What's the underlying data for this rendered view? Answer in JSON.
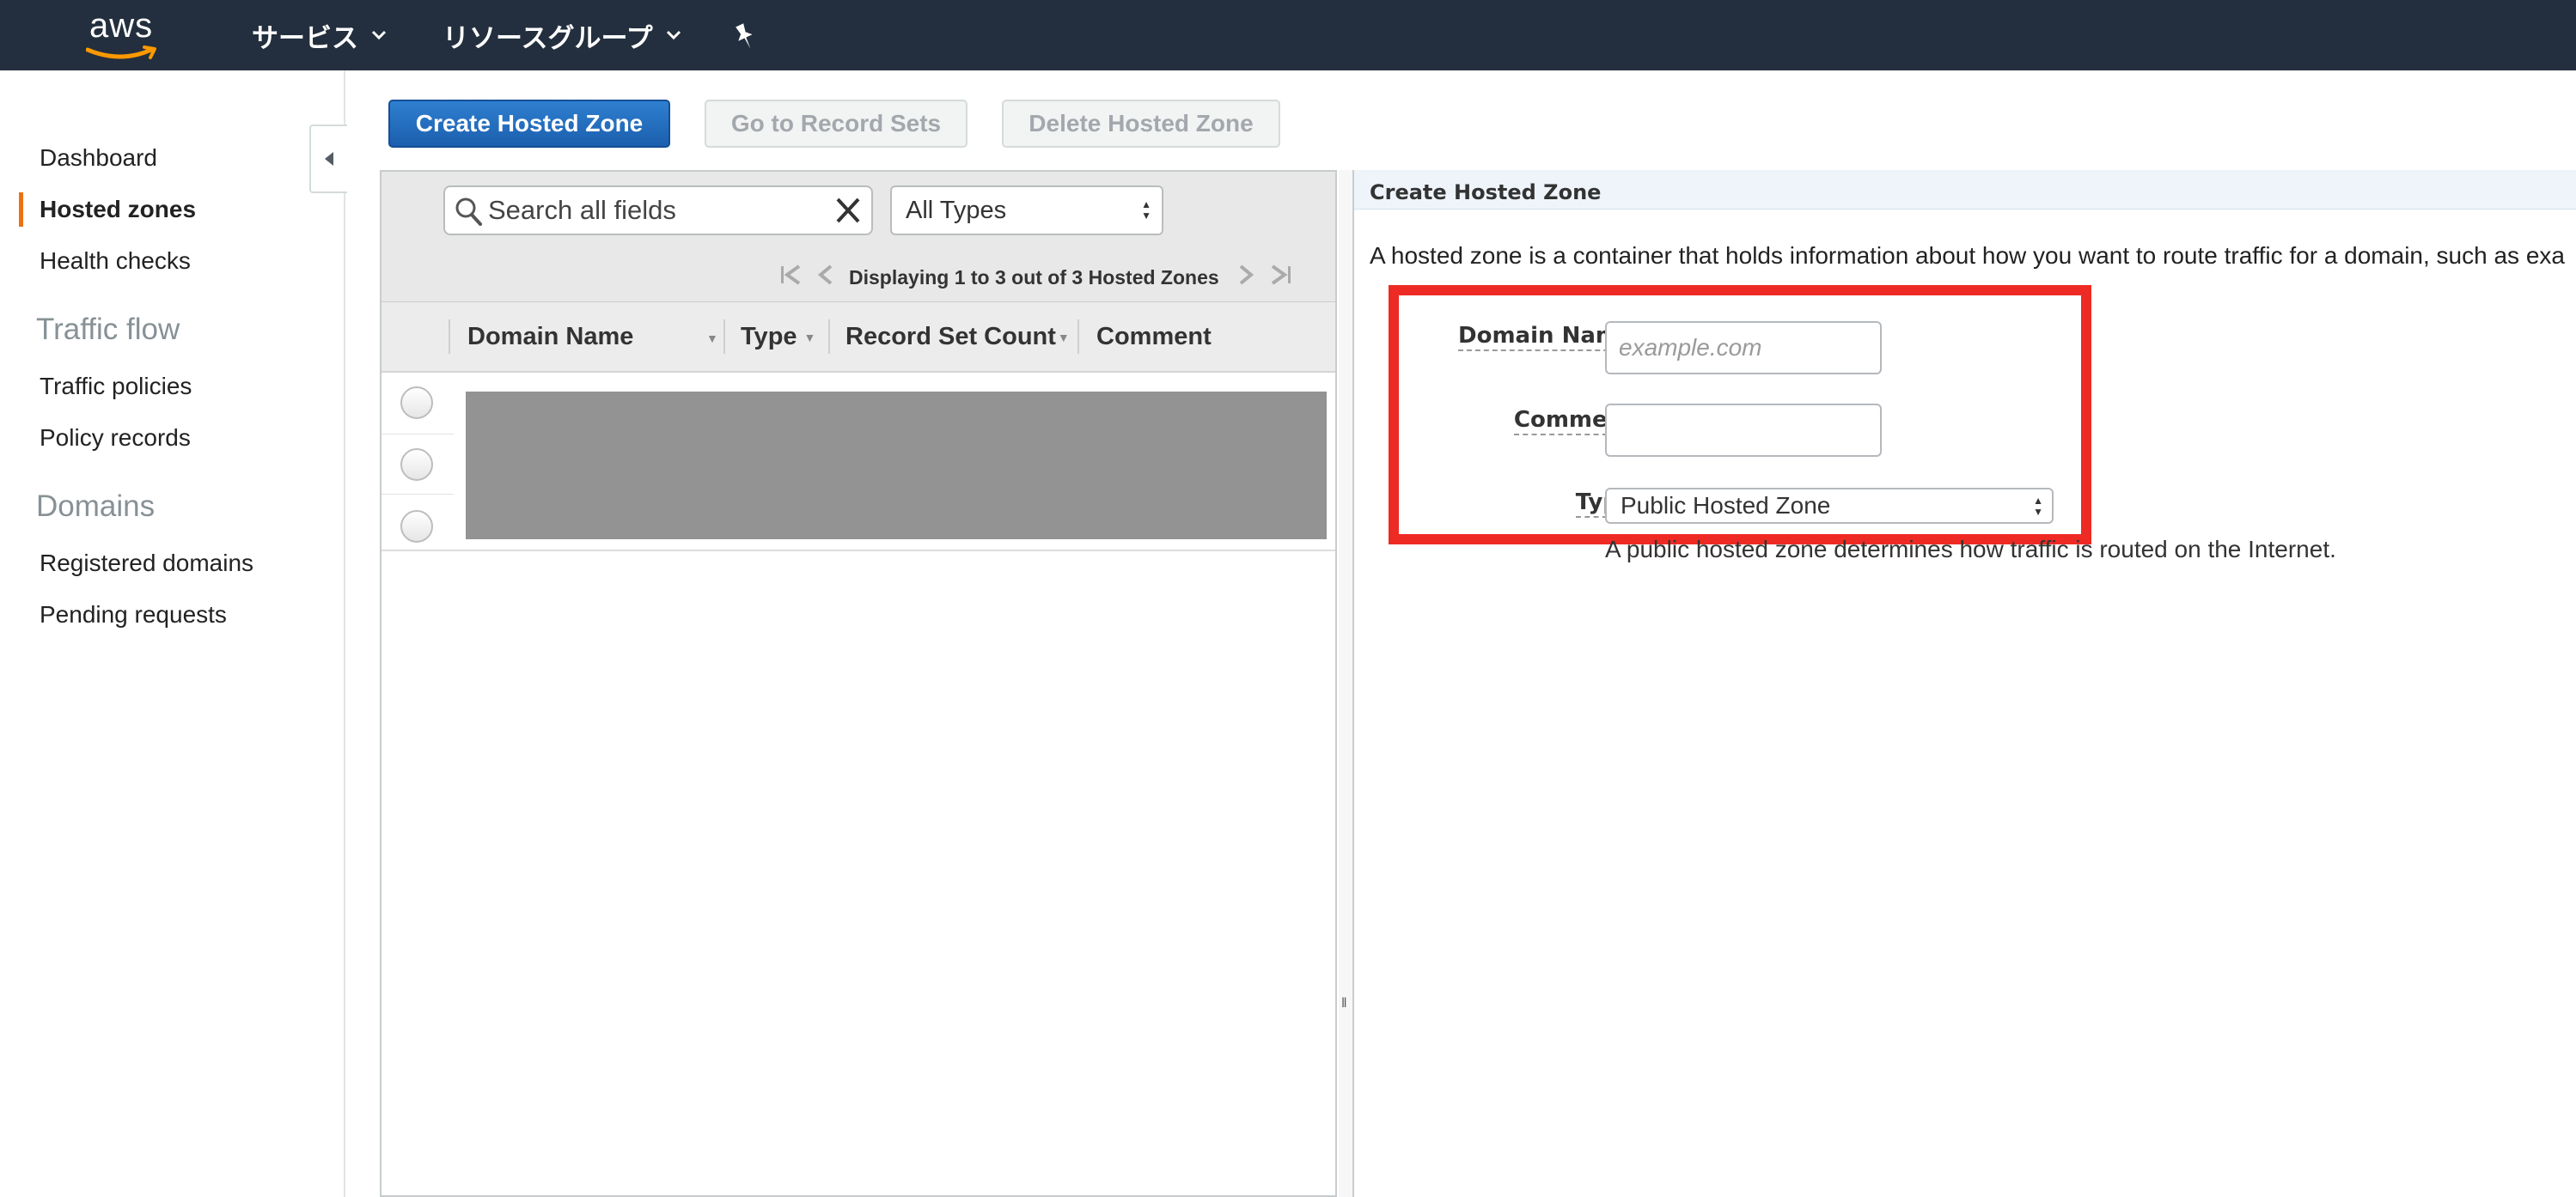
{
  "topnav": {
    "logo_text": "aws",
    "services_label": "サービス",
    "resource_groups_label": "リソースグループ"
  },
  "sidebar": {
    "items": [
      {
        "label": "Dashboard"
      },
      {
        "label": "Hosted zones",
        "active": true
      },
      {
        "label": "Health checks"
      }
    ],
    "traffic_flow": {
      "heading": "Traffic flow",
      "items": [
        {
          "label": "Traffic policies"
        },
        {
          "label": "Policy records"
        }
      ]
    },
    "domains": {
      "heading": "Domains",
      "items": [
        {
          "label": "Registered domains"
        },
        {
          "label": "Pending requests"
        }
      ]
    }
  },
  "actions": {
    "create_label": "Create Hosted Zone",
    "record_sets_label": "Go to Record Sets",
    "delete_label": "Delete Hosted Zone"
  },
  "list": {
    "search_placeholder": "Search all fields",
    "type_filter": "All Types",
    "pagination_text": "Displaying 1 to 3 out of 3 Hosted Zones",
    "columns": [
      "Domain Name",
      "Type",
      "Record Set Count",
      "Comment"
    ],
    "row_count": 3
  },
  "form": {
    "title": "Create Hosted Zone",
    "description": "A hosted zone is a container that holds information about how you want to route traffic for a domain, such as exa",
    "domain_label": "Domain Name:",
    "domain_placeholder": "example.com",
    "comment_label": "Comment:",
    "comment_value": "",
    "type_label": "Type:",
    "type_value": "Public Hosted Zone",
    "type_hint": "A public hosted zone determines how traffic is routed on the Internet."
  },
  "colors": {
    "topbar": "#232f3e",
    "accent_orange": "#ec7211",
    "primary_button": "#1f66b7",
    "highlight_red": "#ee2a24"
  }
}
